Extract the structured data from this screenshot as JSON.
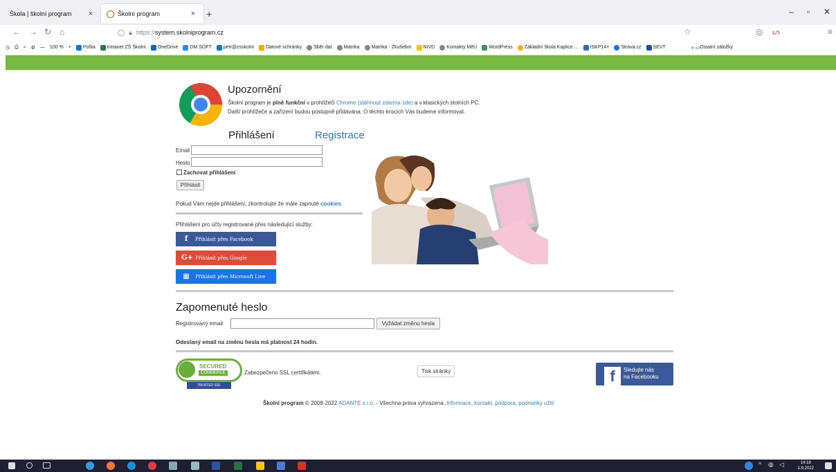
{
  "browser": {
    "tabs": [
      {
        "title": "Škola | školní program",
        "active": false
      },
      {
        "title": "Školní program",
        "active": true
      }
    ],
    "new_tab": "+",
    "close_glyph": "×",
    "url_scheme": "https://",
    "url_host": "system.skolniprogram.cz",
    "zoom": "100 %",
    "bookmarks": [
      "Pošta",
      "Intranet ZŠ Školní",
      "OneDrive",
      "DM SOFT",
      "petr@zsskolni",
      "Datové schránky",
      "Sběr dat",
      "Matrika",
      "Matrika - Zkušební",
      "NIVD",
      "Kontakty MěÚ",
      "WordPress",
      "Základní škola Kaplice ...",
      "ISKP14+",
      "Strava.cz",
      "SEVT"
    ],
    "other_bookmarks": "Ostatní záložky"
  },
  "notice": {
    "title": "Upozornění",
    "line1_a": "Školní program je ",
    "line1_bold": "plně funkční",
    "line1_b": " v prohlížeči ",
    "line1_link": "Chrome (stáhnout zdarma zde)",
    "line1_c": " a v klasických stolních PC.",
    "line2": "Další prohlížeče a zařízení budou postupně přidávána. O těchto krocích Vás budeme informovat."
  },
  "login": {
    "tab_login": "Přihlášení",
    "tab_register": "Registrace",
    "email_label": "Email",
    "password_label": "Heslo",
    "remember_label": "Zachovat přihlášení",
    "submit_label": "Přihlásit",
    "cookies_a": "Pokud Vám nejde přihlášení, zkontrolujte že máte zapnuté ",
    "cookies_link": "cookies",
    "cookies_b": ".",
    "services_text": "Přihlášení pro účty registrované přes následující služby:",
    "facebook_label": "Přihlásit přes Facebook",
    "google_label": "Přihlásit přes Google",
    "microsoft_label": "Přihlásit přes Microsoft Live"
  },
  "forgot": {
    "title": "Zapomenuté heslo",
    "email_label": "Registrovaný email",
    "button_label": "Vyžádat změnu hesla",
    "validity_note": "Odeslaný email na změnu hesla má platnost 24 hodin."
  },
  "ssl": {
    "text": "Zabezpečeno SSL certifikátem.",
    "badge_secured": "SECURED",
    "badge_commerce": "COMMERCE",
    "badge_trusted": "TRUSTED SSL"
  },
  "print_label": "Tisk stránky",
  "facebook_follow": {
    "line1": "Sledujte nás",
    "line2": "na Facebooku"
  },
  "footer": {
    "brand": "Školní program",
    "copyright": " © 2008-2022 ",
    "company_link": "ADANTE s.r.o.",
    "rights": " - Všechna práva vyhrazena. ",
    "info_link": "Informace, kontakt, podpora, podmínky užití"
  },
  "taskbar": {
    "time": "14:18",
    "date": "1.9.2022"
  },
  "colors": {
    "green_bar": "#78b943",
    "facebook": "#3b5998",
    "google": "#dd4b39",
    "microsoft": "#1a73e8",
    "link": "#3a7bd5"
  }
}
